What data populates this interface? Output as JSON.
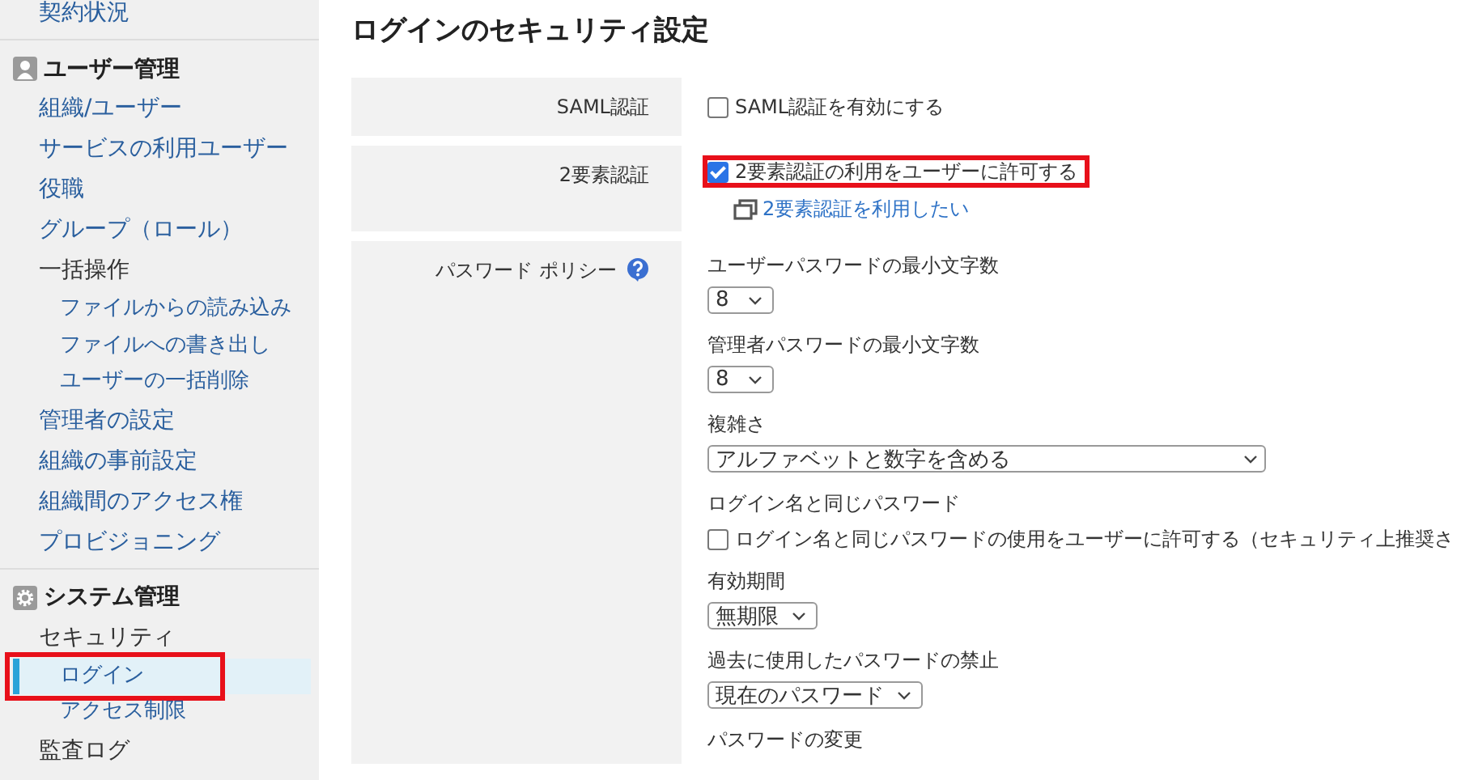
{
  "sidebar": {
    "sections": [
      {
        "items": [
          {
            "kind": "link",
            "label": "契約状況",
            "selected": false,
            "highlighted": false
          }
        ]
      },
      {
        "title": "ユーザー管理",
        "items": [
          {
            "kind": "link",
            "label": "組織/ユーザー",
            "selected": false,
            "highlighted": false
          },
          {
            "kind": "link",
            "label": "サービスの利用ユーザー",
            "selected": false,
            "highlighted": false
          },
          {
            "kind": "link",
            "label": "役職",
            "selected": false,
            "highlighted": false
          },
          {
            "kind": "link",
            "label": "グループ（ロール）",
            "selected": false,
            "highlighted": false
          },
          {
            "kind": "heading",
            "label": "一括操作",
            "selected": false,
            "highlighted": false,
            "children": [
              {
                "kind": "link",
                "label": "ファイルからの読み込み",
                "selected": false,
                "highlighted": false
              },
              {
                "kind": "link",
                "label": "ファイルへの書き出し",
                "selected": false,
                "highlighted": false
              },
              {
                "kind": "link",
                "label": "ユーザーの一括削除",
                "selected": false,
                "highlighted": false
              }
            ]
          },
          {
            "kind": "link",
            "label": "管理者の設定",
            "selected": false,
            "highlighted": false
          },
          {
            "kind": "link",
            "label": "組織の事前設定",
            "selected": false,
            "highlighted": false
          },
          {
            "kind": "link",
            "label": "組織間のアクセス権",
            "selected": false,
            "highlighted": false
          },
          {
            "kind": "link",
            "label": "プロビジョニング",
            "selected": false,
            "highlighted": false
          }
        ]
      },
      {
        "title": "システム管理",
        "items": [
          {
            "kind": "heading",
            "label": "セキュリティ",
            "selected": false,
            "highlighted": false,
            "children": [
              {
                "kind": "link",
                "label": "ログイン",
                "selected": true,
                "highlighted": true
              },
              {
                "kind": "link",
                "label": "アクセス制限",
                "selected": false,
                "highlighted": false
              }
            ]
          },
          {
            "kind": "heading",
            "label": "監査ログ",
            "selected": false,
            "highlighted": false
          }
        ]
      }
    ]
  },
  "page": {
    "title": "ログインのセキュリティ設定",
    "rows": [
      {
        "label": "SAML認証",
        "help": false,
        "fields": [
          {
            "kind": "checkbox",
            "label": "SAML認証を有効にする",
            "checked": false,
            "highlighted": false
          }
        ]
      },
      {
        "label": "2要素認証",
        "help": false,
        "fields": [
          {
            "kind": "checkbox",
            "label": "2要素認証の利用をユーザーに許可する",
            "checked": true,
            "highlighted": true
          },
          {
            "kind": "link",
            "label": "2要素認証を利用したい"
          }
        ]
      },
      {
        "label": "パスワード ポリシー",
        "help": true,
        "fields": [
          {
            "kind": "caption",
            "label": "ユーザーパスワードの最小文字数"
          },
          {
            "kind": "select",
            "value": "8",
            "wide": false
          },
          {
            "kind": "caption",
            "label": "管理者パスワードの最小文字数"
          },
          {
            "kind": "select",
            "value": "8",
            "wide": false
          },
          {
            "kind": "caption",
            "label": "複雑さ"
          },
          {
            "kind": "select",
            "value": "アルファベットと数字を含める",
            "wide": true
          },
          {
            "kind": "caption",
            "label": "ログイン名と同じパスワード"
          },
          {
            "kind": "checkbox",
            "label": "ログイン名と同じパスワードの使用をユーザーに許可する（セキュリティ上推奨さ",
            "checked": false,
            "highlighted": false
          },
          {
            "kind": "caption",
            "label": "有効期間"
          },
          {
            "kind": "select",
            "value": "無期限",
            "wide": false
          },
          {
            "kind": "caption",
            "label": "過去に使用したパスワードの禁止"
          },
          {
            "kind": "select",
            "value": "現在のパスワード",
            "wide": false
          },
          {
            "kind": "caption",
            "label": "パスワードの変更"
          }
        ]
      }
    ]
  }
}
